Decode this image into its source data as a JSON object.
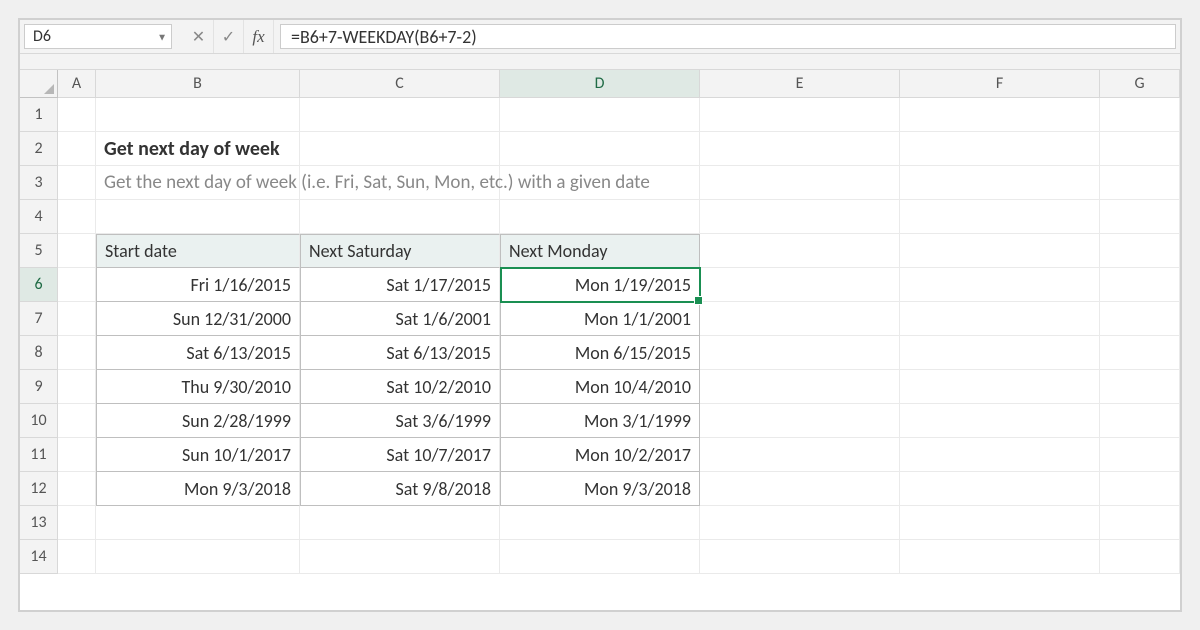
{
  "name_box": "D6",
  "formula": "=B6+7-WEEKDAY(B6+7-2)",
  "columns": [
    "A",
    "B",
    "C",
    "D",
    "E",
    "F",
    "G"
  ],
  "rows": [
    "1",
    "2",
    "3",
    "4",
    "5",
    "6",
    "7",
    "8",
    "9",
    "10",
    "11",
    "12",
    "13",
    "14"
  ],
  "active_col": "D",
  "active_row": "6",
  "content": {
    "title": "Get next day of week",
    "subtitle": "Get the next day of week (i.e. Fri, Sat, Sun, Mon, etc.) with a given date",
    "table": {
      "headers": [
        "Start date",
        "Next Saturday",
        "Next Monday"
      ],
      "rows": [
        [
          "Fri 1/16/2015",
          "Sat 1/17/2015",
          "Mon 1/19/2015"
        ],
        [
          "Sun 12/31/2000",
          "Sat 1/6/2001",
          "Mon 1/1/2001"
        ],
        [
          "Sat 6/13/2015",
          "Sat 6/13/2015",
          "Mon 6/15/2015"
        ],
        [
          "Thu 9/30/2010",
          "Sat 10/2/2010",
          "Mon 10/4/2010"
        ],
        [
          "Sun 2/28/1999",
          "Sat 3/6/1999",
          "Mon 3/1/1999"
        ],
        [
          "Sun 10/1/2017",
          "Sat 10/7/2017",
          "Mon 10/2/2017"
        ],
        [
          "Mon 9/3/2018",
          "Sat 9/8/2018",
          "Mon 9/3/2018"
        ]
      ]
    }
  },
  "fx_label": "fx"
}
